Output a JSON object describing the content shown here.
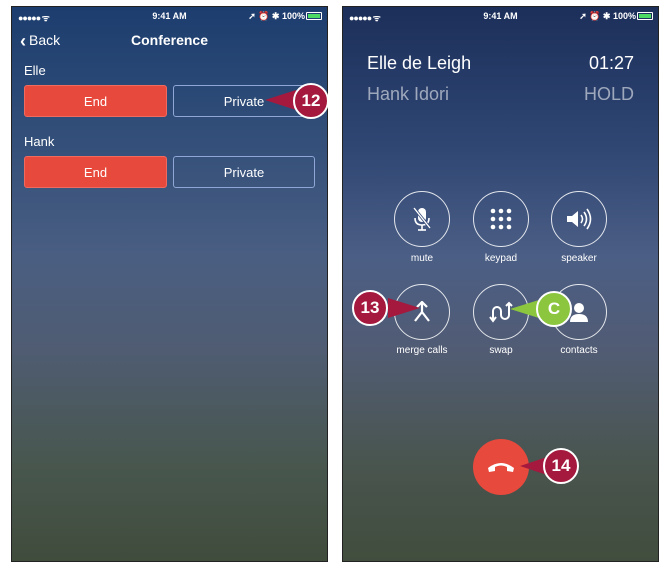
{
  "status": {
    "signal": "●●●●● ᯤ",
    "time": "9:41 AM",
    "right": "➚ ⏰ ✱ 100%"
  },
  "left": {
    "back_label": "Back",
    "title": "Conference",
    "callers": [
      {
        "name": "Elle",
        "end_label": "End",
        "private_label": "Private"
      },
      {
        "name": "Hank",
        "end_label": "End",
        "private_label": "Private"
      }
    ]
  },
  "right": {
    "active_caller": "Elle de Leigh",
    "active_time": "01:27",
    "held_caller": "Hank Idori",
    "held_status": "HOLD",
    "buttons": [
      {
        "label": "mute",
        "icon": "mute-icon"
      },
      {
        "label": "keypad",
        "icon": "keypad-icon"
      },
      {
        "label": "speaker",
        "icon": "speaker-icon"
      },
      {
        "label": "merge calls",
        "icon": "merge-calls-icon"
      },
      {
        "label": "swap",
        "icon": "swap-icon"
      },
      {
        "label": "contacts",
        "icon": "contacts-icon"
      }
    ],
    "end_call_icon": "end-call-icon"
  },
  "callouts": {
    "c12": "12",
    "c13": "13",
    "c14": "14",
    "cC": "C"
  },
  "colors": {
    "end_red": "#e8493d",
    "callout_red": "#a4193d",
    "callout_green": "#8cc63e"
  }
}
